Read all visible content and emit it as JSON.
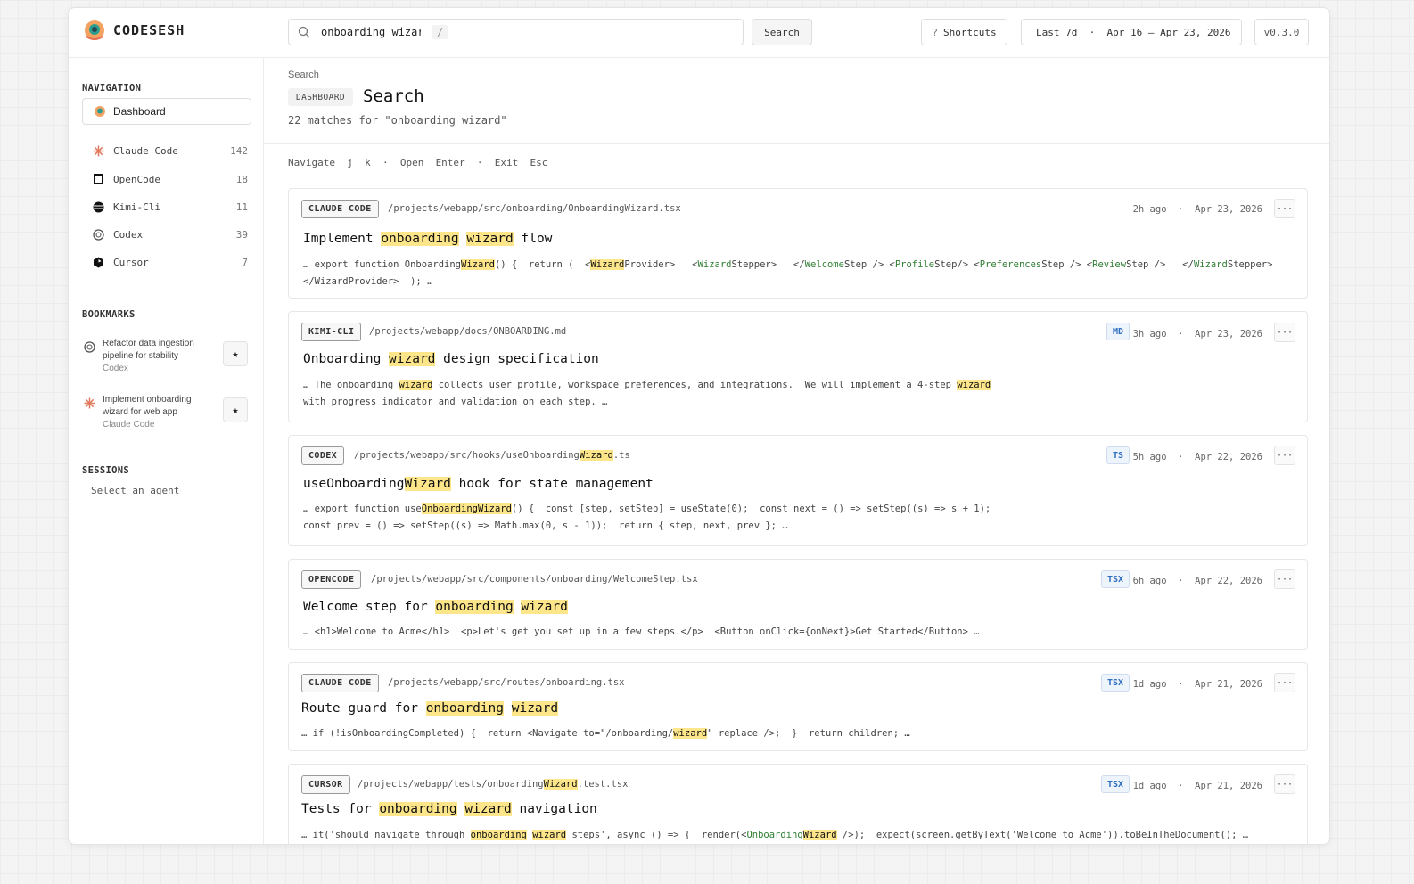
{
  "app": {
    "name": "CODESESH",
    "version": "v0.3.0"
  },
  "topbar": {
    "search_value": "onboarding wizard",
    "slash_hint": "/",
    "search_button": "Search",
    "shortcuts_label": "Shortcuts",
    "shortcuts_glyph": "?",
    "date_range": "Last 7d  ·  Apr 16 – Apr 23, 2026"
  },
  "sidebar": {
    "navigation_heading": "NAVIGATION",
    "dashboard_label": "Dashboard",
    "agents": [
      {
        "name": "Claude Code",
        "count": "142",
        "icon": "claude-code-icon",
        "color": "#e07a5f"
      },
      {
        "name": "OpenCode",
        "count": "18",
        "icon": "opencode-icon",
        "color": "#111111"
      },
      {
        "name": "Kimi-Cli",
        "count": "11",
        "icon": "kimi-icon",
        "color": "#111111"
      },
      {
        "name": "Codex",
        "count": "39",
        "icon": "codex-icon",
        "color": "#555555"
      },
      {
        "name": "Cursor",
        "count": "7",
        "icon": "cursor-icon",
        "color": "#111111"
      }
    ],
    "bookmarks_heading": "BOOKMARKS",
    "bookmarks": [
      {
        "line1": "Refactor data ingestion",
        "line2": "pipeline for stability",
        "agent": "Codex"
      },
      {
        "line1": "Implement onboarding",
        "line2": "wizard for web app",
        "agent": "Claude Code"
      }
    ],
    "sessions_heading": "SESSIONS",
    "sessions_placeholder": "Select an agent"
  },
  "main": {
    "breadcrumb": "Search",
    "section_badge": "DASHBOARD",
    "title": "Search",
    "match_summary": "22 matches for \"onboarding wizard\"",
    "hint": "Navigate  j  k  ·  Open  Enter  ·  Exit  Esc"
  },
  "results": [
    {
      "agent": "CLAUDE CODE",
      "path": "/projects/webapp/src/onboarding/OnboardingWizard.tsx",
      "ext": "",
      "time": "2h ago  ·  Apr 23, 2026",
      "title": "Implement onboarding wizard flow",
      "snippet": "… export function OnboardingWizard() {  return (  <WizardProvider>   <WizardStepper>   </WelcomeStep /> <ProfileStep/> <PreferencesStep /> <ReviewStep />   </WizardStepper>\n  </WizardProvider>  ); …"
    },
    {
      "agent": "KIMI-CLI",
      "path": "/projects/webapp/docs/ONBOARDING.md",
      "ext": "MD",
      "time": "3h ago  ·  Apr 23, 2026",
      "title": "Onboarding wizard design specification",
      "snippet": "… The onboarding wizard collects user profile, workspace preferences, and integrations.  We will implement a 4-step wizard\nwith progress indicator and validation on each step. …"
    },
    {
      "agent": "CODEX",
      "path": "/projects/webapp/src/hooks/useOnboardingWizard.ts",
      "ext": "TS",
      "time": "5h ago  ·  Apr 22, 2026",
      "title": "useOnboardingWizard hook for state management",
      "snippet": "… export function useOnboardingWizard() {  const [step, setStep] = useState(0);  const next = () => setStep((s) => s + 1);\nconst prev = () => setStep((s) => Math.max(0, s - 1));  return { step, next, prev }; …"
    },
    {
      "agent": "OPENCODE",
      "path": "/projects/webapp/src/components/onboarding/WelcomeStep.tsx",
      "ext": "TSX",
      "time": "6h ago  ·  Apr 22, 2026",
      "title": "Welcome step for onboarding wizard",
      "snippet": "… <h1>Welcome to Acme</h1>  <p>Let's get you set up in a few steps.</p>  <Button onClick={onNext}>Get Started</Button> …"
    },
    {
      "agent": "CLAUDE CODE",
      "path": "/projects/webapp/src/routes/onboarding.tsx",
      "ext": "TSX",
      "time": "1d ago  ·  Apr 21, 2026",
      "title": "Route guard for onboarding wizard",
      "snippet": "… if (!isOnboardingCompleted) {  return <Navigate to=\"/onboarding/wizard\" replace />;  }  return children; …"
    },
    {
      "agent": "CURSOR",
      "path": "/projects/webapp/tests/onboardingWizard.test.tsx",
      "ext": "TSX",
      "time": "1d ago  ·  Apr 21, 2026",
      "title": "Tests for onboarding wizard navigation",
      "snippet": "… it('should navigate through onboarding wizard steps', async () => {  render(<OnboardingWizard />);  expect(screen.getByText('Welcome to Acme')).toBeInTheDocument(); …"
    }
  ],
  "colors": {
    "highlight": "#fde68a",
    "accent_blue": "#2f6fbf",
    "jsx_green": "#2e7d32"
  }
}
